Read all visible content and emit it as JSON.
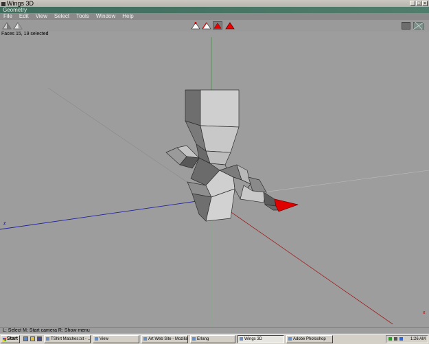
{
  "window": {
    "title": "Wings 3D",
    "controls": [
      "_",
      "□",
      "×"
    ]
  },
  "geometry_window": {
    "title": "Geometry"
  },
  "menu": [
    "File",
    "Edit",
    "View",
    "Select",
    "Tools",
    "Window",
    "Help"
  ],
  "status": {
    "selection_info": "Faces 15, 19 selected"
  },
  "viewport": {
    "axis_label_z": "z",
    "close_marker": "x"
  },
  "help_bar": {
    "text": "L: Select  M: Start camera  R: Show menu"
  },
  "taskbar": {
    "start_label": "Start",
    "tasks": [
      {
        "label": "TShirt Matches.txt - ..."
      },
      {
        "label": "View"
      },
      {
        "label": "Art Web Site - Mozilla"
      },
      {
        "label": "Erlang"
      },
      {
        "label": "Wings 3D"
      },
      {
        "label": "Adobe Photoshop"
      }
    ],
    "clock": "1:26 AM"
  },
  "colors": {
    "selected_face": "#e00000",
    "accent": "#3d6b5c"
  }
}
